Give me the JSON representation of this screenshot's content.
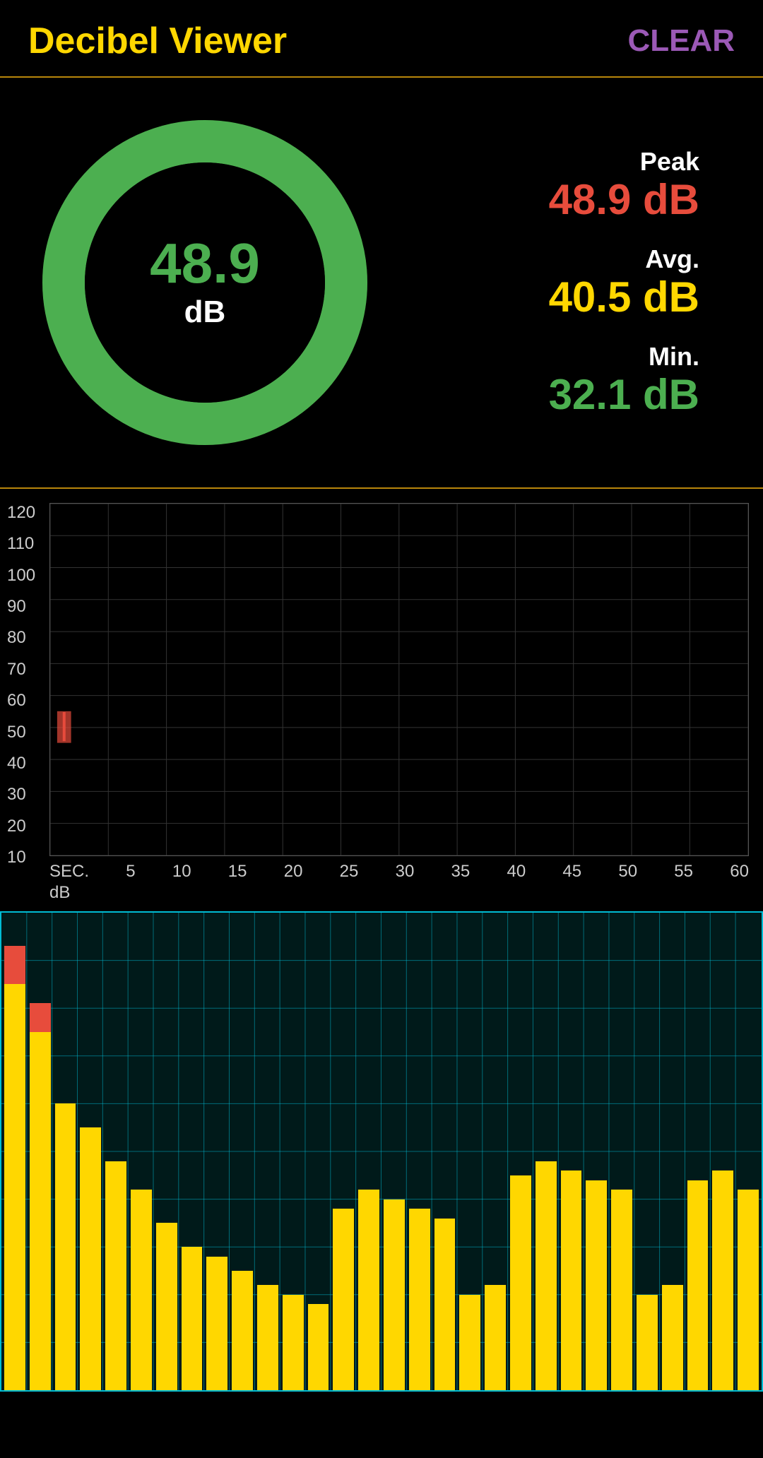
{
  "header": {
    "title": "Decibel Viewer",
    "clear_label": "CLEAR"
  },
  "gauge": {
    "value": "48.9",
    "unit": "dB",
    "color": "#4CAF50",
    "ring_color": "#4CAF50",
    "ring_bg": "#1a3300"
  },
  "stats": {
    "peak": {
      "label": "Peak",
      "value": "48.9 dB",
      "color": "#e74c3c"
    },
    "avg": {
      "label": "Avg.",
      "value": "40.5 dB",
      "color": "#FFD700"
    },
    "min": {
      "label": "Min.",
      "value": "32.1 dB",
      "color": "#4CAF50"
    }
  },
  "line_chart": {
    "y_labels": [
      "120",
      "110",
      "100",
      "90",
      "80",
      "70",
      "60",
      "50",
      "40",
      "30",
      "20",
      "10",
      "dB"
    ],
    "x_labels": [
      "SEC.",
      "5",
      "10",
      "15",
      "20",
      "25",
      "30",
      "35",
      "40",
      "45",
      "50",
      "55",
      "60"
    ]
  },
  "spectrum_bars": {
    "bars": [
      {
        "main_pct": 85,
        "top_pct": 8
      },
      {
        "main_pct": 75,
        "top_pct": 6
      },
      {
        "main_pct": 60,
        "top_pct": 0
      },
      {
        "main_pct": 55,
        "top_pct": 0
      },
      {
        "main_pct": 48,
        "top_pct": 0
      },
      {
        "main_pct": 42,
        "top_pct": 0
      },
      {
        "main_pct": 35,
        "top_pct": 0
      },
      {
        "main_pct": 30,
        "top_pct": 0
      },
      {
        "main_pct": 28,
        "top_pct": 0
      },
      {
        "main_pct": 25,
        "top_pct": 0
      },
      {
        "main_pct": 22,
        "top_pct": 0
      },
      {
        "main_pct": 20,
        "top_pct": 0
      },
      {
        "main_pct": 18,
        "top_pct": 0
      },
      {
        "main_pct": 38,
        "top_pct": 0
      },
      {
        "main_pct": 42,
        "top_pct": 0
      },
      {
        "main_pct": 40,
        "top_pct": 0
      },
      {
        "main_pct": 38,
        "top_pct": 0
      },
      {
        "main_pct": 36,
        "top_pct": 0
      },
      {
        "main_pct": 20,
        "top_pct": 0
      },
      {
        "main_pct": 22,
        "top_pct": 0
      },
      {
        "main_pct": 45,
        "top_pct": 0
      },
      {
        "main_pct": 48,
        "top_pct": 0
      },
      {
        "main_pct": 46,
        "top_pct": 0
      },
      {
        "main_pct": 44,
        "top_pct": 0
      },
      {
        "main_pct": 42,
        "top_pct": 0
      },
      {
        "main_pct": 20,
        "top_pct": 0
      },
      {
        "main_pct": 22,
        "top_pct": 0
      },
      {
        "main_pct": 44,
        "top_pct": 0
      },
      {
        "main_pct": 46,
        "top_pct": 0
      },
      {
        "main_pct": 42,
        "top_pct": 0
      }
    ]
  }
}
